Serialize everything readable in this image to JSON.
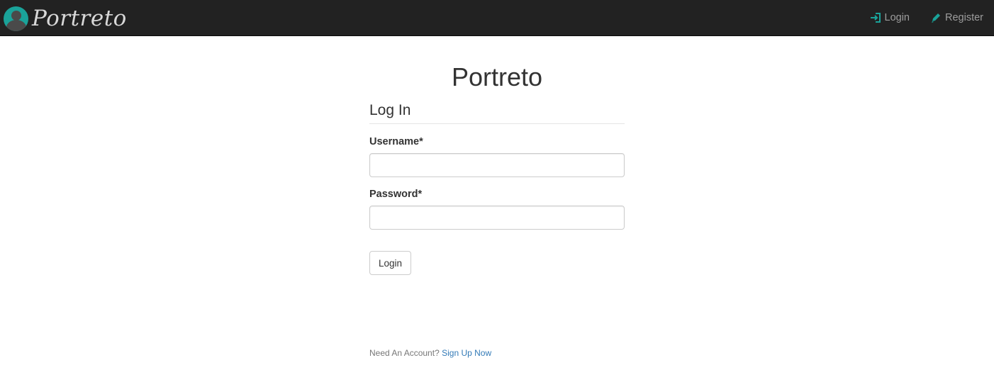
{
  "navbar": {
    "brand_name": "Portreto",
    "logo_icon": "avatar-logo-icon",
    "links": [
      {
        "label": "Login",
        "icon": "login-arrow-icon"
      },
      {
        "label": "Register",
        "icon": "pencil-icon"
      }
    ]
  },
  "main": {
    "site_title": "Portreto",
    "form_title": "Log In",
    "username_label": "Username*",
    "username_value": "",
    "password_label": "Password*",
    "password_value": "",
    "login_button": "Login",
    "signup_prompt": "Need An Account?",
    "signup_link": "Sign Up Now"
  },
  "colors": {
    "navbar_bg": "#222222",
    "accent": "#1aa39a",
    "link": "#337ab7",
    "nav_text": "#9d9d9d"
  }
}
